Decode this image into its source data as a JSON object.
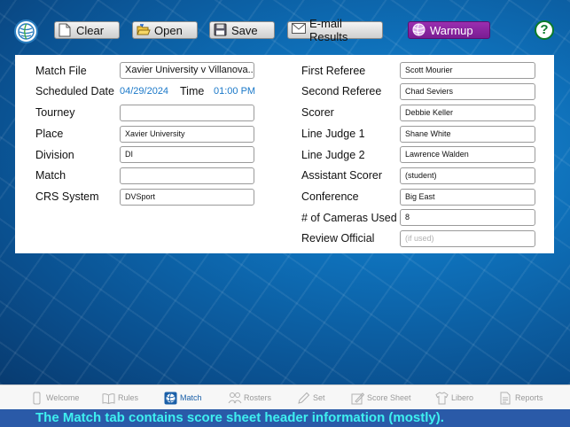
{
  "toolbar": {
    "clear_label": "Clear",
    "open_label": "Open",
    "save_label": "Save",
    "email_label": "E-mail Results",
    "warmup_label": "Warmup",
    "help_label": "?"
  },
  "left": {
    "match_file": {
      "label": "Match File",
      "value": "Xavier University v Villanova..."
    },
    "scheduled_date": {
      "label": "Scheduled Date",
      "date": "04/29/2024",
      "time_label": "Time",
      "time": "01:00 PM"
    },
    "tourney": {
      "label": "Tourney",
      "value": ""
    },
    "place": {
      "label": "Place",
      "value": "Xavier University"
    },
    "division": {
      "label": "Division",
      "value": "DI"
    },
    "match": {
      "label": "Match",
      "value": ""
    },
    "crs_system": {
      "label": "CRS System",
      "value": "DVSport"
    }
  },
  "right": {
    "first_referee": {
      "label": "First Referee",
      "value": "Scott Mourier"
    },
    "second_referee": {
      "label": "Second Referee",
      "value": "Chad Seviers"
    },
    "scorer": {
      "label": "Scorer",
      "value": "Debbie Keller"
    },
    "line_judge_1": {
      "label": "Line Judge 1",
      "value": "Shane White"
    },
    "line_judge_2": {
      "label": "Line Judge 2",
      "value": "Lawrence Walden"
    },
    "assistant_scorer": {
      "label": "Assistant Scorer",
      "value": "(student)"
    },
    "conference": {
      "label": "Conference",
      "value": "Big East"
    },
    "cameras": {
      "label": "# of Cameras Used",
      "value": "8"
    },
    "review_official": {
      "label": "Review Official",
      "placeholder": "(if used)"
    }
  },
  "tabs": [
    {
      "label": "Welcome",
      "icon": "phone-icon"
    },
    {
      "label": "Rules",
      "icon": "book-icon"
    },
    {
      "label": "Match",
      "icon": "volleyball-icon",
      "active": true
    },
    {
      "label": "Rosters",
      "icon": "people-icon"
    },
    {
      "label": "Set",
      "icon": "pencil-icon"
    },
    {
      "label": "Score Sheet",
      "icon": "score-sheet-icon"
    },
    {
      "label": "Libero",
      "icon": "jersey-icon"
    },
    {
      "label": "Reports",
      "icon": "report-icon"
    }
  ],
  "caption": "The Match tab contains score sheet header information (mostly).",
  "colors": {
    "accent": "#1a78c8",
    "warmup": "#8a25a2",
    "caption_text": "#3ef0f0",
    "caption_bg": "#2a5aa8"
  }
}
